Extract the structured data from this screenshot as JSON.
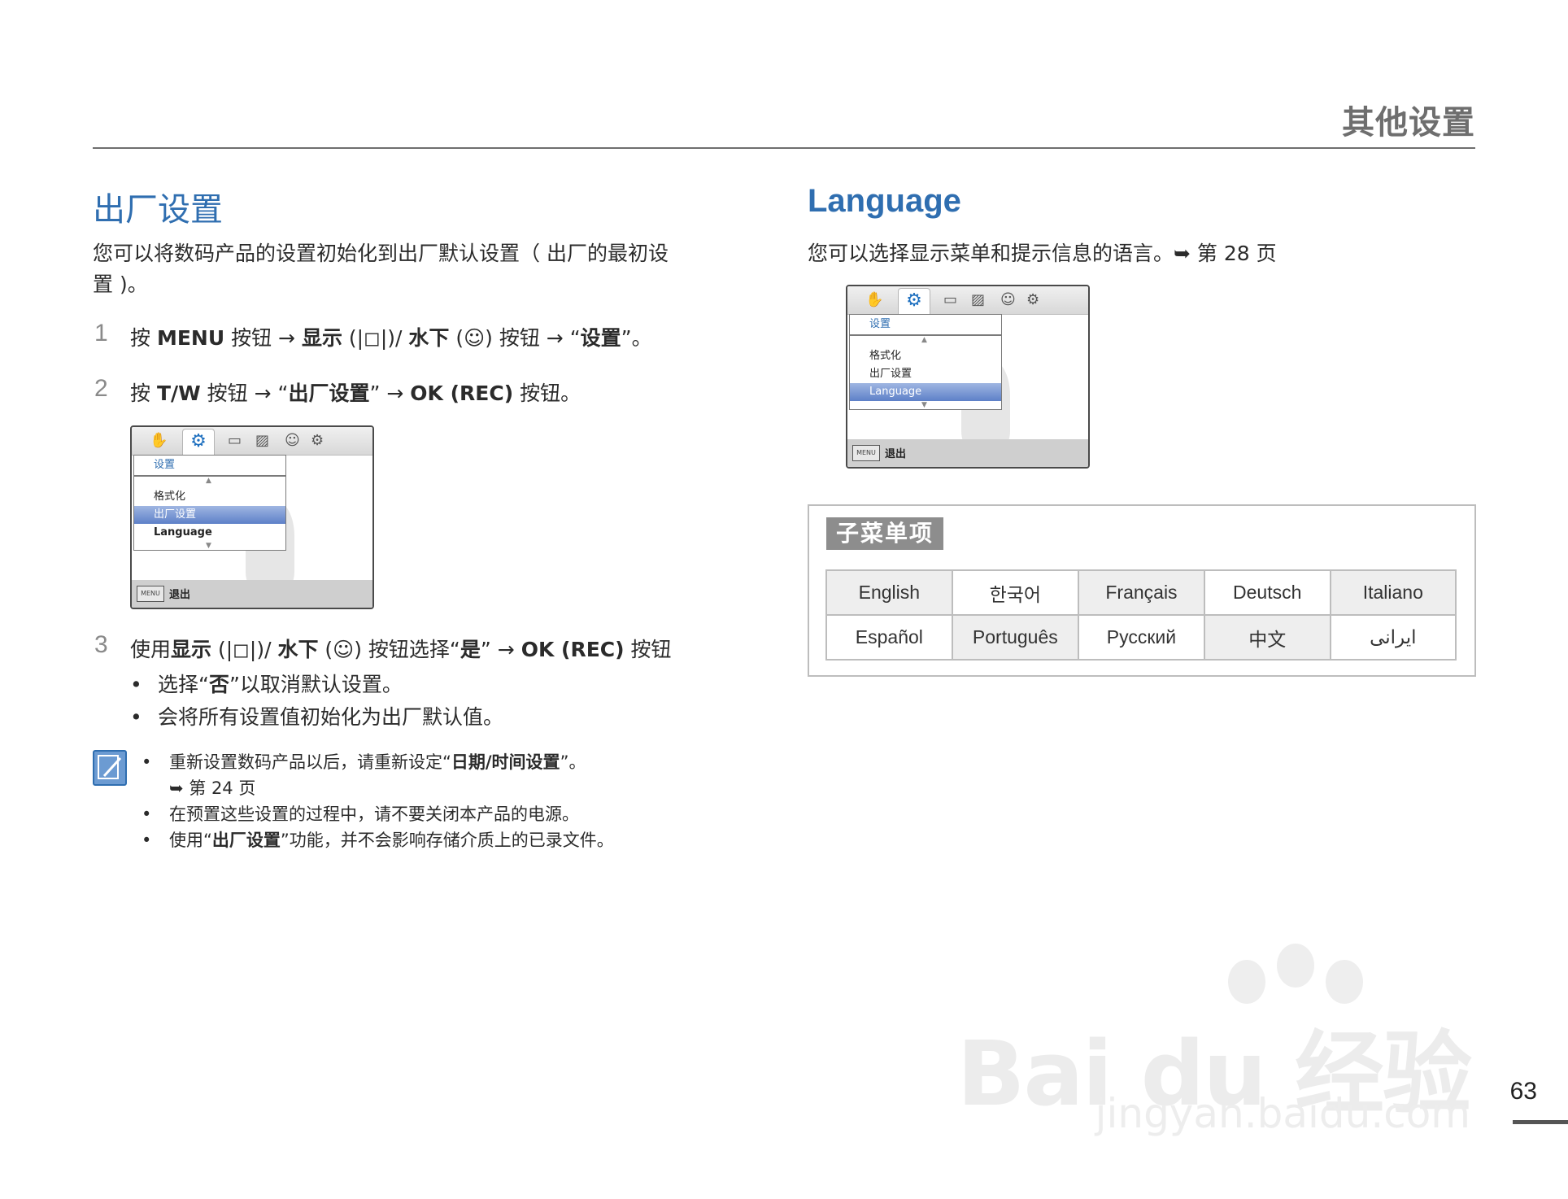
{
  "header": {
    "title": "其他设置"
  },
  "left": {
    "title": "出厂设置",
    "intro_line1": "您可以将数码产品的设置初始化到出厂默认设置（ 出厂的最初设",
    "intro_line2": "置 )。",
    "steps": [
      {
        "num": "1",
        "t1": "按 ",
        "b1": "MENU",
        "t2": " 按钮 → ",
        "b2": "显示",
        "t3": " (|◻|)/ ",
        "b3": "水下",
        "t4": " (☺) 按钮 → “",
        "b4": "设置",
        "t5": "”。"
      },
      {
        "num": "2",
        "t1": "按 ",
        "b1": "T/W",
        "t2": " 按钮 → “",
        "b2": "出厂设置",
        "t3": "” → ",
        "b3": "OK (REC)",
        "t4": " 按钮。"
      },
      {
        "num": "3",
        "t1": "使用",
        "b1": "显示",
        "t2": " (|◻|)/ ",
        "b2": "水下",
        "t3": " (☺) 按钮选择“",
        "b3": "是",
        "t4": "” → ",
        "b4": "OK (REC)",
        "t5": " 按钮"
      }
    ],
    "bullets": [
      {
        "t1": "选择“",
        "b1": "否",
        "t2": "”以取消默认设置。"
      },
      {
        "t1": "会将所有设置值初始化为出厂默认值。"
      }
    ],
    "screen": {
      "menu_title": "设置",
      "items": [
        "格式化",
        "出厂设置",
        "Language"
      ],
      "selected": "出厂设置",
      "footer_badge": "MENU",
      "footer_label": "退出"
    },
    "notes": [
      {
        "t1": "重新设置数码产品以后，请重新设定“",
        "b1": "日期/时间设置",
        "t2": "”。",
        "ref": "➥ 第 24 页"
      },
      {
        "t1": "在预置这些设置的过程中，请不要关闭本产品的电源。"
      },
      {
        "t1": "使用“",
        "b1": "出厂设置",
        "t2": "”功能，并不会影响存储介质上的已录文件。"
      }
    ]
  },
  "right": {
    "title": "Language",
    "intro": "您可以选择显示菜单和提示信息的语言。➥ 第 28 页",
    "screen": {
      "menu_title": "设置",
      "items": [
        "格式化",
        "出厂设置",
        "Language"
      ],
      "selected": "Language",
      "footer_badge": "MENU",
      "footer_label": "退出"
    },
    "submenu_label": "子菜单项",
    "languages": [
      [
        "English",
        "한국어",
        "Français",
        "Deutsch",
        "Italiano"
      ],
      [
        "Español",
        "Português",
        "Русский",
        "中文",
        "ایرانی"
      ]
    ]
  },
  "watermark": {
    "main": "Bai du 经验",
    "sub": "jingyan.baidu.com"
  },
  "page_number": "63"
}
